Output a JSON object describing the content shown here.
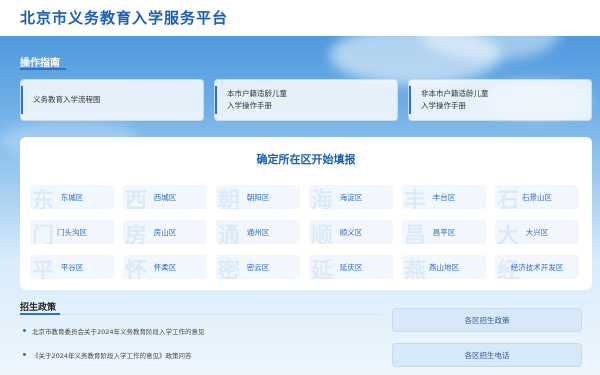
{
  "header": {
    "title": "北京市义务教育入学服务平台"
  },
  "guide": {
    "heading": "操作指南",
    "cards": [
      {
        "line1": "义务教育入学流程图",
        "line2": ""
      },
      {
        "line1": "本市户籍适龄儿童",
        "line2": "入学操作手册"
      },
      {
        "line1": "非本市户籍适龄儿童",
        "line2": "入学操作手册"
      }
    ]
  },
  "district_panel": {
    "title": "确定所在区开始填报",
    "districts": [
      {
        "label": "东城区",
        "char": "东"
      },
      {
        "label": "西城区",
        "char": "西"
      },
      {
        "label": "朝阳区",
        "char": "朝"
      },
      {
        "label": "海淀区",
        "char": "海"
      },
      {
        "label": "丰台区",
        "char": "丰"
      },
      {
        "label": "石景山区",
        "char": "石"
      },
      {
        "label": "门头沟区",
        "char": "门"
      },
      {
        "label": "房山区",
        "char": "房"
      },
      {
        "label": "通州区",
        "char": "通"
      },
      {
        "label": "顺义区",
        "char": "顺"
      },
      {
        "label": "昌平区",
        "char": "昌"
      },
      {
        "label": "大兴区",
        "char": "大"
      },
      {
        "label": "平谷区",
        "char": "平"
      },
      {
        "label": "怀柔区",
        "char": "怀"
      },
      {
        "label": "密云区",
        "char": "密"
      },
      {
        "label": "延庆区",
        "char": "延"
      },
      {
        "label": "燕山地区",
        "char": "燕"
      },
      {
        "label": "经济技术开发区",
        "char": "经"
      }
    ]
  },
  "policy": {
    "heading": "招生政策",
    "items": [
      "北京市教育委员会关于2024年义务教育阶段入学工作的意见",
      "《关于2024年义务教育阶段入学工作的意见》政策问答"
    ]
  },
  "side_buttons": {
    "district_policy": "各区招生政策",
    "district_phone": "各区招生电话"
  }
}
